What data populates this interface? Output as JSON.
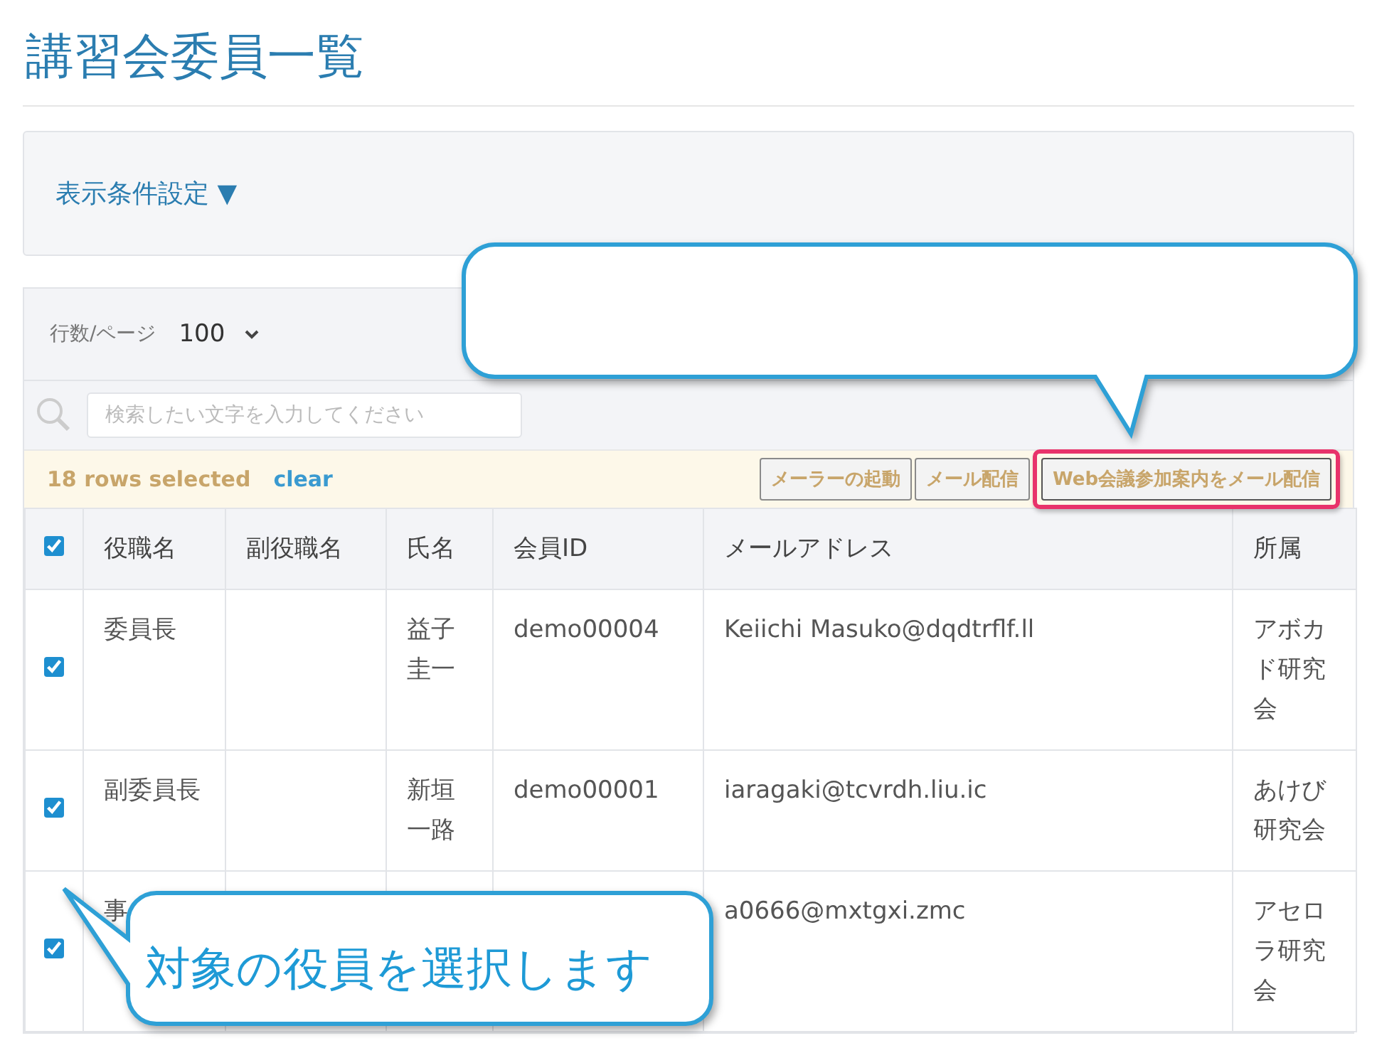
{
  "title": "講習会委員一覧",
  "filter_panel": {
    "label": "表示条件設定",
    "toggle": "▼"
  },
  "pager": {
    "label": "行数/ページ",
    "value": "100"
  },
  "search": {
    "placeholder": "検索したい文字を入力してください"
  },
  "selection_bar": {
    "count_text": "18 rows selected",
    "clear_link": "clear",
    "buttons": [
      {
        "label": "メーラーの起動",
        "highlighted": false
      },
      {
        "label": "メール配信",
        "highlighted": false
      },
      {
        "label": "Web会議参加案内をメール配信",
        "highlighted": true
      }
    ]
  },
  "table": {
    "header_checked": true,
    "columns": [
      "役職名",
      "副役職名",
      "氏名",
      "会員ID",
      "メールアドレス",
      "所属"
    ],
    "rows": [
      {
        "checked": true,
        "cells": [
          "委員長",
          null,
          "益子圭一",
          "demo00004",
          "Keiichi Masuko@dqdtrflf.ll",
          "アボカド研究会"
        ]
      },
      {
        "checked": true,
        "cells": [
          "副委員長",
          null,
          "新垣一路",
          "demo00001",
          "iaragaki@tcvrdh.liu.ic",
          "あけび研究会"
        ]
      },
      {
        "checked": true,
        "cells": [
          "事",
          null,
          null,
          null,
          "a0666@mxtgxi.zmc",
          "アセロラ研究会"
        ]
      }
    ]
  },
  "callouts": [
    {
      "kind": "top"
    },
    {
      "kind": "bottom",
      "text": "対象の役員を選択します"
    }
  ]
}
